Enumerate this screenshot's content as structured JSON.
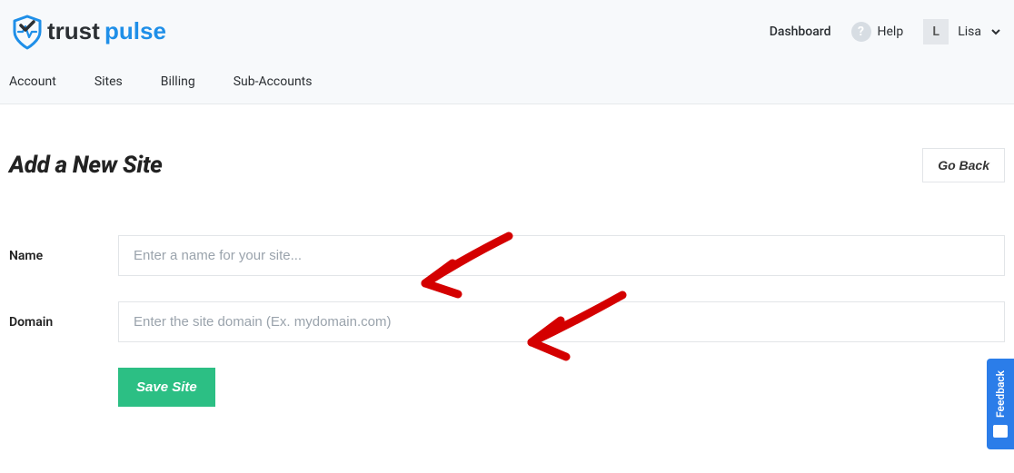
{
  "header": {
    "brand_trust": "trust",
    "brand_pulse": "pulse",
    "dashboard": "Dashboard",
    "help": "Help",
    "help_icon_char": "?",
    "user_initial": "L",
    "user_name": "Lisa"
  },
  "tabs": {
    "items": [
      {
        "label": "Account"
      },
      {
        "label": "Sites"
      },
      {
        "label": "Billing"
      },
      {
        "label": "Sub-Accounts"
      }
    ]
  },
  "page": {
    "title": "Add a New Site",
    "go_back": "Go Back"
  },
  "form": {
    "name_label": "Name",
    "name_placeholder": "Enter a name for your site...",
    "domain_label": "Domain",
    "domain_placeholder": "Enter the site domain (Ex. mydomain.com)",
    "save": "Save Site"
  },
  "feedback": {
    "label": "Feedback"
  }
}
